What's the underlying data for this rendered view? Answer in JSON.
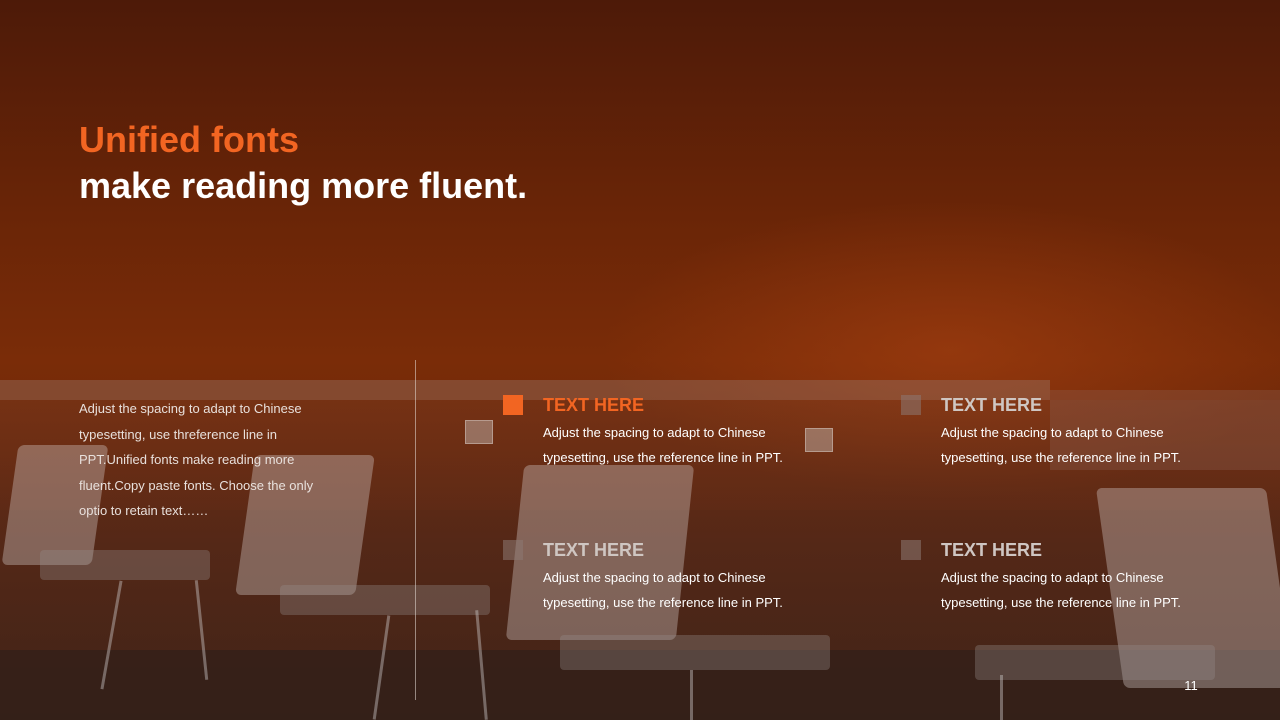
{
  "title": {
    "line1": "Unified fonts",
    "line2": "make reading more fluent."
  },
  "intro_text": "Adjust the spacing to adapt to Chinese typesetting, use threference line in PPT.Unified fonts make reading more fluent.Copy paste fonts. Choose the only optio to retain text……",
  "items": [
    {
      "heading": "TEXT HERE",
      "body": "Adjust the spacing to adapt to Chinese typesetting, use the reference line in PPT."
    },
    {
      "heading": "TEXT HERE",
      "body": "Adjust the spacing to adapt to Chinese typesetting, use the reference line in PPT."
    },
    {
      "heading": "TEXT HERE",
      "body": "Adjust the spacing to adapt to Chinese typesetting, use the reference line in PPT."
    },
    {
      "heading": "TEXT HERE",
      "body": "Adjust the spacing to adapt to Chinese typesetting, use the reference line in PPT."
    }
  ],
  "page_number": "11",
  "colors": {
    "accent": "#f26522",
    "background": "#6a2507",
    "text": "#ffffff"
  }
}
